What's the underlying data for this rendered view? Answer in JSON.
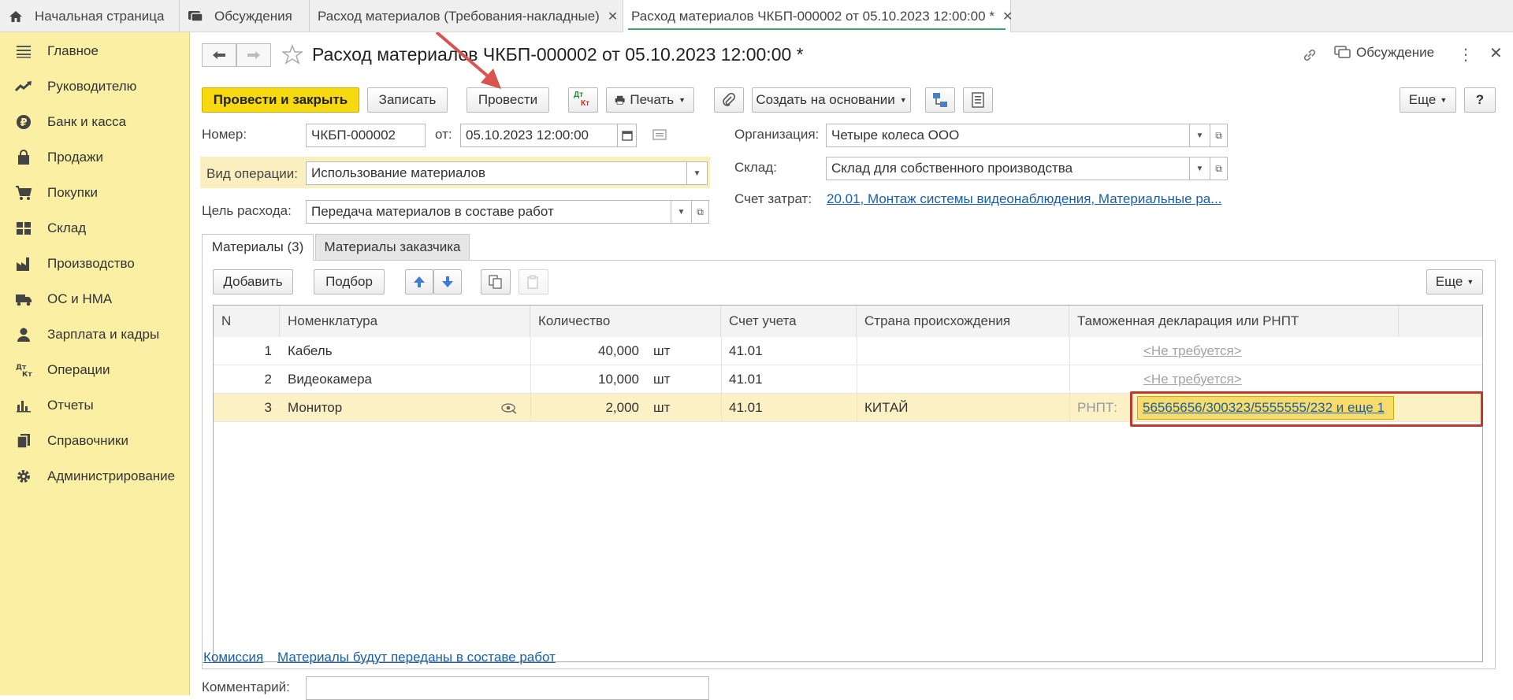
{
  "tabs": [
    {
      "label": "Начальная страница"
    },
    {
      "label": "Обсуждения"
    },
    {
      "label": "Расход материалов (Требования-накладные)"
    },
    {
      "label": "Расход материалов ЧКБП-000002 от 05.10.2023 12:00:00 *"
    }
  ],
  "sidebar": {
    "items": [
      {
        "label": "Главное",
        "icon": "menu-lines-icon"
      },
      {
        "label": "Руководителю",
        "icon": "trend-icon"
      },
      {
        "label": "Банк и касса",
        "icon": "ruble-coin-icon"
      },
      {
        "label": "Продажи",
        "icon": "bag-icon"
      },
      {
        "label": "Покупки",
        "icon": "cart-icon"
      },
      {
        "label": "Склад",
        "icon": "warehouse-grid-icon"
      },
      {
        "label": "Производство",
        "icon": "factory-icon"
      },
      {
        "label": "ОС и НМА",
        "icon": "truck-icon"
      },
      {
        "label": "Зарплата и кадры",
        "icon": "person-icon"
      },
      {
        "label": "Операции",
        "icon": "dt-kt-icon"
      },
      {
        "label": "Отчеты",
        "icon": "bar-chart-icon"
      },
      {
        "label": "Справочники",
        "icon": "books-icon"
      },
      {
        "label": "Администрирование",
        "icon": "gear-icon"
      }
    ]
  },
  "header": {
    "title": "Расход материалов ЧКБП-000002 от 05.10.2023 12:00:00 *",
    "discussion": "Обсуждение"
  },
  "toolbar": {
    "post_close": "Провести и закрыть",
    "save": "Записать",
    "post": "Провести",
    "dtkt_top": "Дт",
    "dtkt_bottom": "Кт",
    "print": "Печать",
    "create_based": "Создать на основании",
    "more": "Еще",
    "help": "?"
  },
  "form": {
    "number_label": "Номер:",
    "number": "ЧКБП-000002",
    "date_label": "от:",
    "date": "05.10.2023 12:00:00",
    "operation_label": "Вид операции:",
    "operation": "Использование материалов",
    "purpose_label": "Цель расхода:",
    "purpose": "Передача материалов в составе работ",
    "org_label": "Организация:",
    "org": "Четыре колеса ООО",
    "warehouse_label": "Склад:",
    "warehouse": "Склад для собственного производства",
    "cost_label": "Счет затрат:",
    "cost": "20.01, Монтаж системы видеонаблюдения, Материальные ра..."
  },
  "form_tabs": [
    {
      "label": "Материалы (3)"
    },
    {
      "label": "Материалы заказчика"
    }
  ],
  "table_toolbar": {
    "add": "Добавить",
    "select": "Подбор",
    "more": "Еще"
  },
  "table": {
    "columns": [
      "N",
      "Номенклатура",
      "Количество",
      "Счет учета",
      "Страна происхождения",
      "Таможенная декларация или РНПТ"
    ],
    "rows": [
      {
        "n": "1",
        "item": "Кабель",
        "qty": "40,000",
        "unit": "шт",
        "account": "41.01",
        "country": "",
        "prefix": "",
        "decl": "<Не требуется>"
      },
      {
        "n": "2",
        "item": "Видеокамера",
        "qty": "10,000",
        "unit": "шт",
        "account": "41.01",
        "country": "",
        "prefix": "",
        "decl": "<Не требуется>"
      },
      {
        "n": "3",
        "item": "Монитор",
        "qty": "2,000",
        "unit": "шт",
        "account": "41.01",
        "country": "КИТАЙ",
        "prefix": "РНПТ:",
        "decl": "56565656/300323/5555555/232 и еще 1"
      }
    ]
  },
  "footer": {
    "commission": "Комиссия",
    "transfer": "Материалы будут переданы в составе работ",
    "comment_label": "Комментарий:"
  },
  "colors": {
    "accent_yellow": "#f6d90f",
    "sidebar_bg": "#fbefa4",
    "highlight_red": "#c0392b",
    "link_blue": "#1a5fa8"
  }
}
